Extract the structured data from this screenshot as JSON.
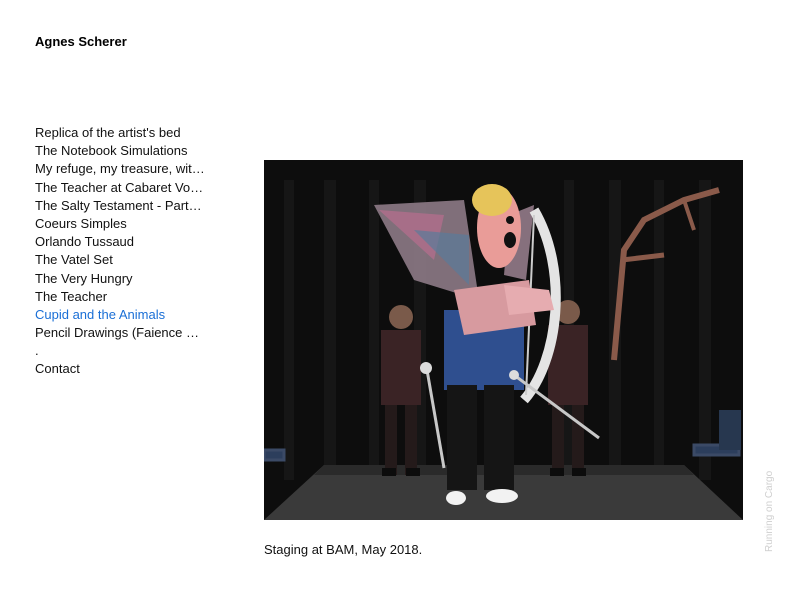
{
  "site": {
    "title": "Agnes Scherer"
  },
  "nav": {
    "items": [
      {
        "label": "Replica of the artist's bed"
      },
      {
        "label": "The Notebook Simulations"
      },
      {
        "label": "My refuge, my treasure, wit…"
      },
      {
        "label": "The Teacher at Cabaret Vo…"
      },
      {
        "label": "The Salty Testament - Part…"
      },
      {
        "label": "Coeurs Simples"
      },
      {
        "label": "Orlando Tussaud"
      },
      {
        "label": "The Vatel Set"
      },
      {
        "label": "The Very Hungry"
      },
      {
        "label": "The Teacher"
      },
      {
        "label": "Cupid and the Animals"
      },
      {
        "label": "Pencil Drawings (Faience …"
      },
      {
        "label": "."
      },
      {
        "label": "Contact"
      }
    ],
    "active_index": 10,
    "active_color": "#1a6fd6"
  },
  "main": {
    "caption": "Staging at BAM, May 2018."
  },
  "footer": {
    "badge": "Running on Cargo"
  }
}
